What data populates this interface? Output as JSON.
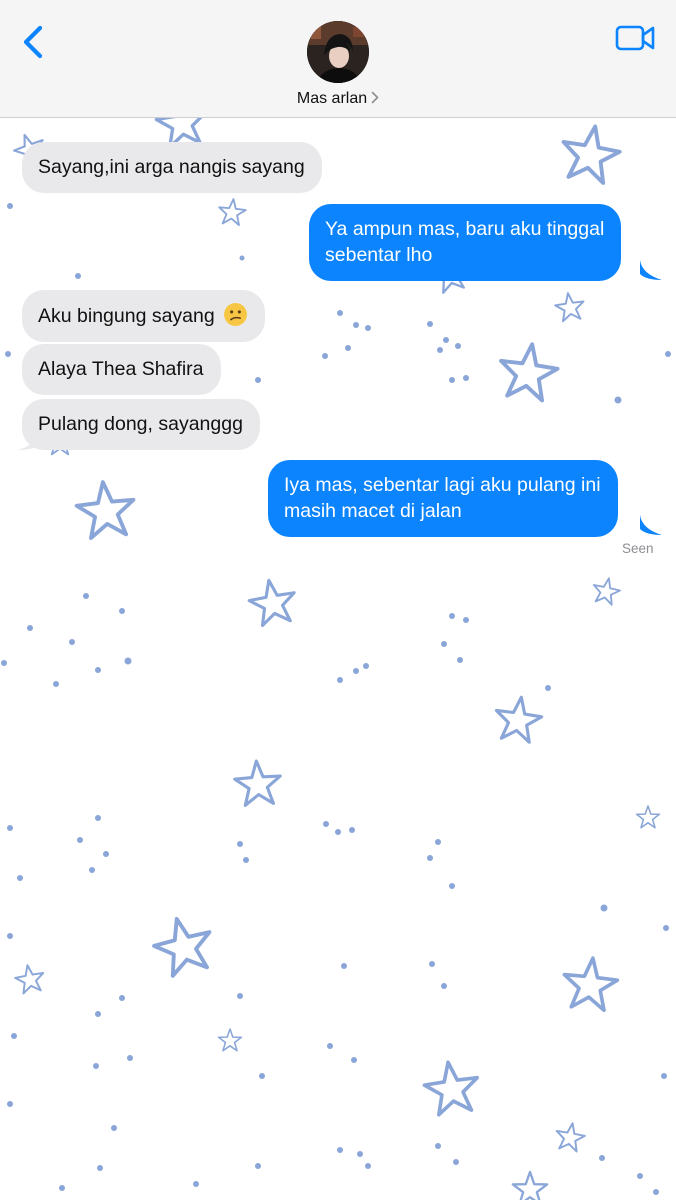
{
  "header": {
    "contact_name": "Mas arlan",
    "back_icon": "chevron-left-icon",
    "video_icon": "video-camera-icon",
    "accent_color": "#0b84fe"
  },
  "messages": [
    {
      "direction": "incoming",
      "text": "Sayang,ini arga nangis sayang"
    },
    {
      "direction": "outgoing",
      "lines": [
        "Ya ampun mas, baru aku tinggal",
        "sebentar lho"
      ]
    },
    {
      "direction": "incoming",
      "text": "Aku bingung sayang",
      "emoji": "confused-face-emoji"
    },
    {
      "direction": "incoming",
      "text": "Alaya Thea Shafira"
    },
    {
      "direction": "incoming",
      "text": "Pulang dong, sayanggg"
    },
    {
      "direction": "outgoing",
      "lines": [
        "Iya mas, sebentar lagi aku pulang ini",
        "masih macet di jalan"
      ]
    }
  ],
  "status": {
    "receipt": "Seen"
  },
  "colors": {
    "incoming_bubble": "#e9e9eb",
    "outgoing_bubble": "#0b84fe",
    "wallpaper_star": "#8aa6d8"
  }
}
